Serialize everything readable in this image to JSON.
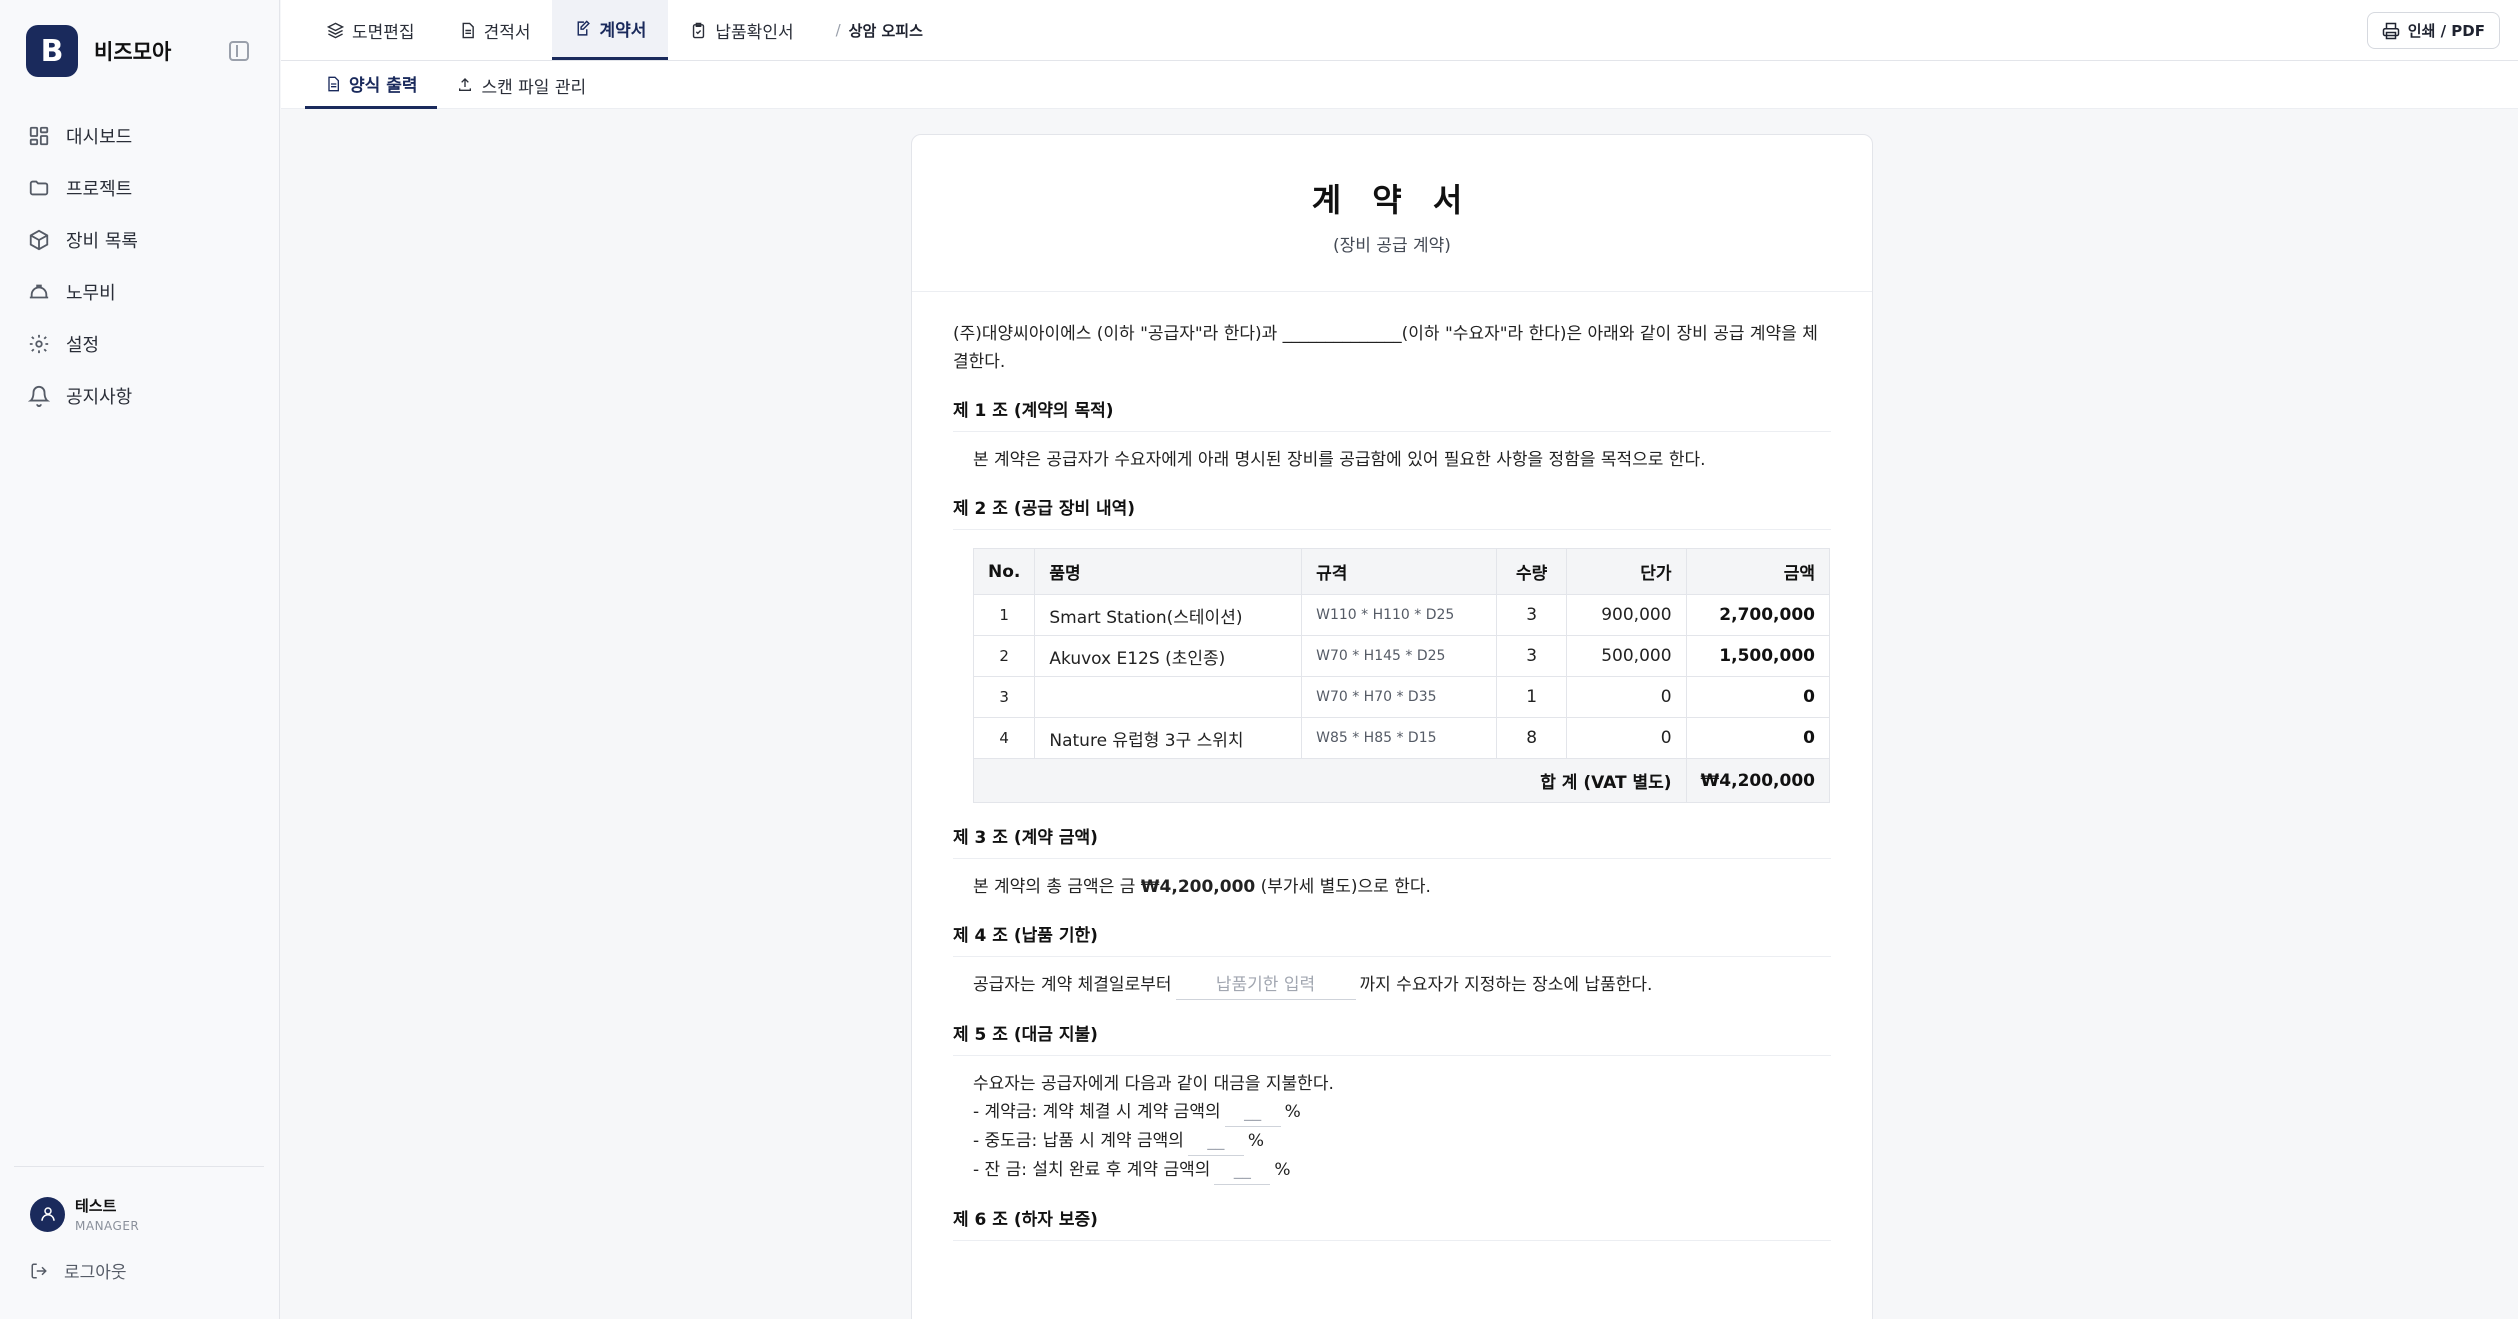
{
  "brand": {
    "logo_letter": "B",
    "name": "비즈모아"
  },
  "sidebar": {
    "items": [
      {
        "label": "대시보드",
        "icon": "dashboard-icon"
      },
      {
        "label": "프로젝트",
        "icon": "folder-icon"
      },
      {
        "label": "장비 목록",
        "icon": "box-icon"
      },
      {
        "label": "노무비",
        "icon": "hardhat-icon"
      },
      {
        "label": "설정",
        "icon": "gear-icon"
      },
      {
        "label": "공지사항",
        "icon": "bell-icon"
      }
    ],
    "user": {
      "name": "테스트",
      "role": "MANAGER"
    },
    "logout_label": "로그아웃"
  },
  "header": {
    "tabs": [
      {
        "label": "도면편집",
        "icon": "layers-icon"
      },
      {
        "label": "견적서",
        "icon": "document-icon"
      },
      {
        "label": "계약서",
        "icon": "edit-document-icon",
        "active": true
      },
      {
        "label": "납품확인서",
        "icon": "clipboard-icon"
      }
    ],
    "breadcrumb_sep": "/",
    "breadcrumb": "상암 오피스",
    "print_label": "인쇄 / PDF"
  },
  "subtabs": [
    {
      "label": "양식 출력",
      "icon": "document-icon",
      "active": true
    },
    {
      "label": "스캔 파일 관리",
      "icon": "upload-icon"
    }
  ],
  "contract": {
    "title": "계 약 서",
    "subtitle": "(장비 공급 계약)",
    "intro": "(주)대양씨아이에스 (이하 \"공급자\"라 한다)과 ______________(이하 \"수요자\"라 한다)은 아래와 같이 장비 공급 계약을 체결한다.",
    "art1": {
      "title": "제 1 조 (계약의 목적)",
      "text": "본 계약은 공급자가 수요자에게 아래 명시된 장비를 공급함에 있어 필요한 사항을 정함을 목적으로 한다."
    },
    "art2": {
      "title": "제 2 조 (공급 장비 내역)",
      "columns": [
        "No.",
        "품명",
        "규격",
        "수량",
        "단가",
        "금액"
      ],
      "rows": [
        {
          "no": "1",
          "name": "Smart Station(스테이션)",
          "spec": "W110 * H110 * D25",
          "qty": "3",
          "price": "900,000",
          "amount": "2,700,000"
        },
        {
          "no": "2",
          "name": "Akuvox E12S (초인종)",
          "spec": "W70 * H145 * D25",
          "qty": "3",
          "price": "500,000",
          "amount": "1,500,000"
        },
        {
          "no": "3",
          "name": "",
          "spec": "W70 * H70 * D35",
          "qty": "1",
          "price": "0",
          "amount": "0"
        },
        {
          "no": "4",
          "name": "Nature 유럽형 3구 스위치",
          "spec": "W85 * H85 * D15",
          "qty": "8",
          "price": "0",
          "amount": "0"
        }
      ],
      "total_label": "합 계 (VAT 별도)",
      "total_value": "₩4,200,000"
    },
    "art3": {
      "title": "제 3 조 (계약 금액)",
      "text_before": "본 계약의 총 금액은 금 ",
      "amount": "₩4,200,000",
      "text_after": " (부가세 별도)으로 한다."
    },
    "art4": {
      "title": "제 4 조 (납품 기한)",
      "text_before": "공급자는 계약 체결일로부터",
      "placeholder": "납품기한 입력",
      "text_after": "까지 수요자가 지정하는 장소에 납품한다."
    },
    "art5": {
      "title": "제 5 조 (대금 지불)",
      "lead": "수요자는 공급자에게 다음과 같이 대금을 지불한다.",
      "lines": [
        {
          "label": "- 계약금: 계약 체결 시 계약 금액의",
          "placeholder": "__",
          "unit": "%"
        },
        {
          "label": "- 중도금: 납품 시 계약 금액의",
          "placeholder": "__",
          "unit": "%"
        },
        {
          "label": "- 잔 금: 설치 완료 후 계약 금액의",
          "placeholder": "__",
          "unit": "%"
        }
      ]
    },
    "art6": {
      "title": "제 6 조 (하자 보증)"
    }
  },
  "colors": {
    "brand": "#1a2a5c",
    "border": "#e3e5ea",
    "background": "#f6f7f9"
  }
}
